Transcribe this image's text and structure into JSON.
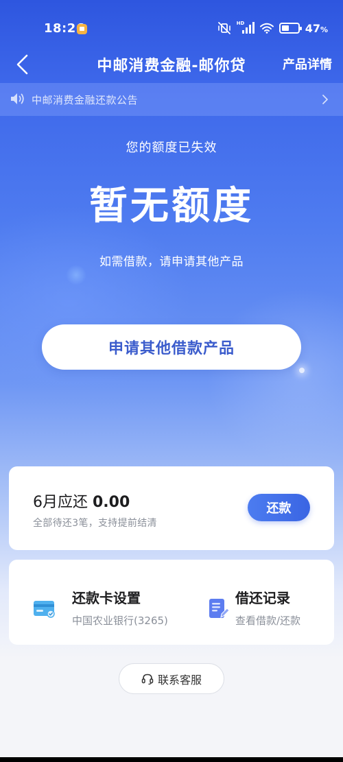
{
  "status_bar": {
    "time": "18:26",
    "signal_label": "HD",
    "battery_percent": 47,
    "battery_text": "47",
    "battery_unit": "%"
  },
  "nav": {
    "title": "中邮消费金融-邮你贷",
    "detail_link": "产品详情",
    "back_icon": "chevron-left-icon"
  },
  "notice": {
    "text": "中邮消费金融还款公告",
    "icon": "speaker-icon"
  },
  "hero": {
    "subtitle": "您的额度已失效",
    "main": "暂无额度",
    "hint": "如需借款，请申请其他产品",
    "apply_button": "申请其他借款产品"
  },
  "repay": {
    "label": "6月应还",
    "amount": "0.00",
    "sub": "全部待还3笔，支持提前结清",
    "button": "还款"
  },
  "tools": [
    {
      "name": "还款卡设置",
      "desc": "中国农业银行(3265)",
      "icon": "bank-card-icon"
    },
    {
      "name": "借还记录",
      "desc": "查看借款/还款",
      "icon": "document-icon"
    }
  ],
  "service": {
    "label": "联系客服",
    "icon": "headset-icon"
  },
  "colors": {
    "primary": "#3a65e3",
    "header_top": "#2e56df",
    "text_dark": "#1d1d1f",
    "text_gray": "#8a8f99"
  }
}
